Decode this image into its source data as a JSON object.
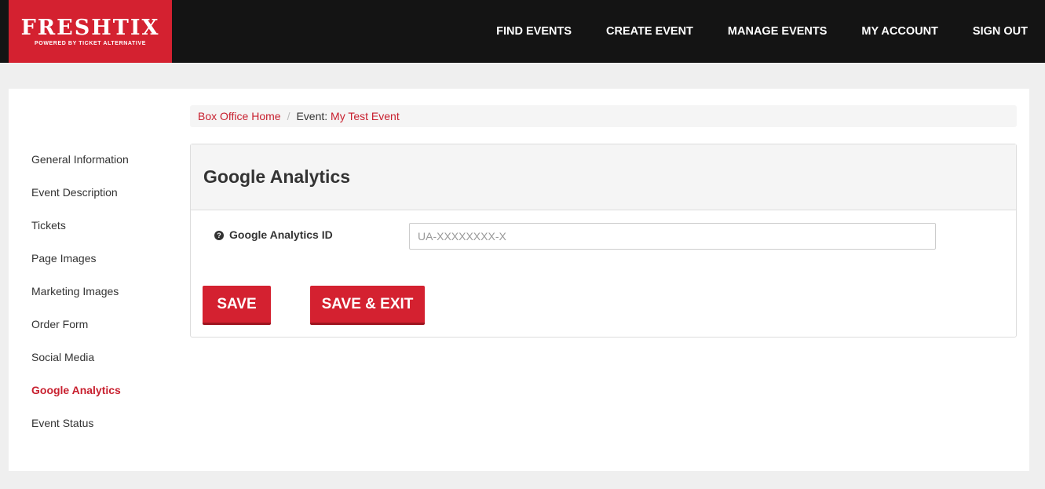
{
  "brand": {
    "title": "FRESHTIX",
    "subtitle": "POWERED BY TICKET ALTERNATIVE",
    "color": "#d42130"
  },
  "nav": {
    "items": [
      "FIND EVENTS",
      "CREATE EVENT",
      "MANAGE EVENTS",
      "MY ACCOUNT",
      "SIGN OUT"
    ]
  },
  "breadcrumb": {
    "home": "Box Office Home",
    "separator": "/",
    "event_prefix": "Event:",
    "event_name": "My Test Event"
  },
  "sidebar": {
    "items": [
      {
        "label": "General Information"
      },
      {
        "label": "Event Description"
      },
      {
        "label": "Tickets"
      },
      {
        "label": "Page Images"
      },
      {
        "label": "Marketing Images"
      },
      {
        "label": "Order Form"
      },
      {
        "label": "Social Media"
      },
      {
        "label": "Google Analytics"
      },
      {
        "label": "Event Status"
      }
    ],
    "active_index": 7
  },
  "panel": {
    "title": "Google Analytics",
    "field_label": "Google Analytics ID",
    "field_value": "",
    "field_placeholder": "UA-XXXXXXXX-X",
    "help_icon": "question-circle-icon"
  },
  "buttons": {
    "save": "SAVE",
    "save_exit": "SAVE & EXIT"
  }
}
